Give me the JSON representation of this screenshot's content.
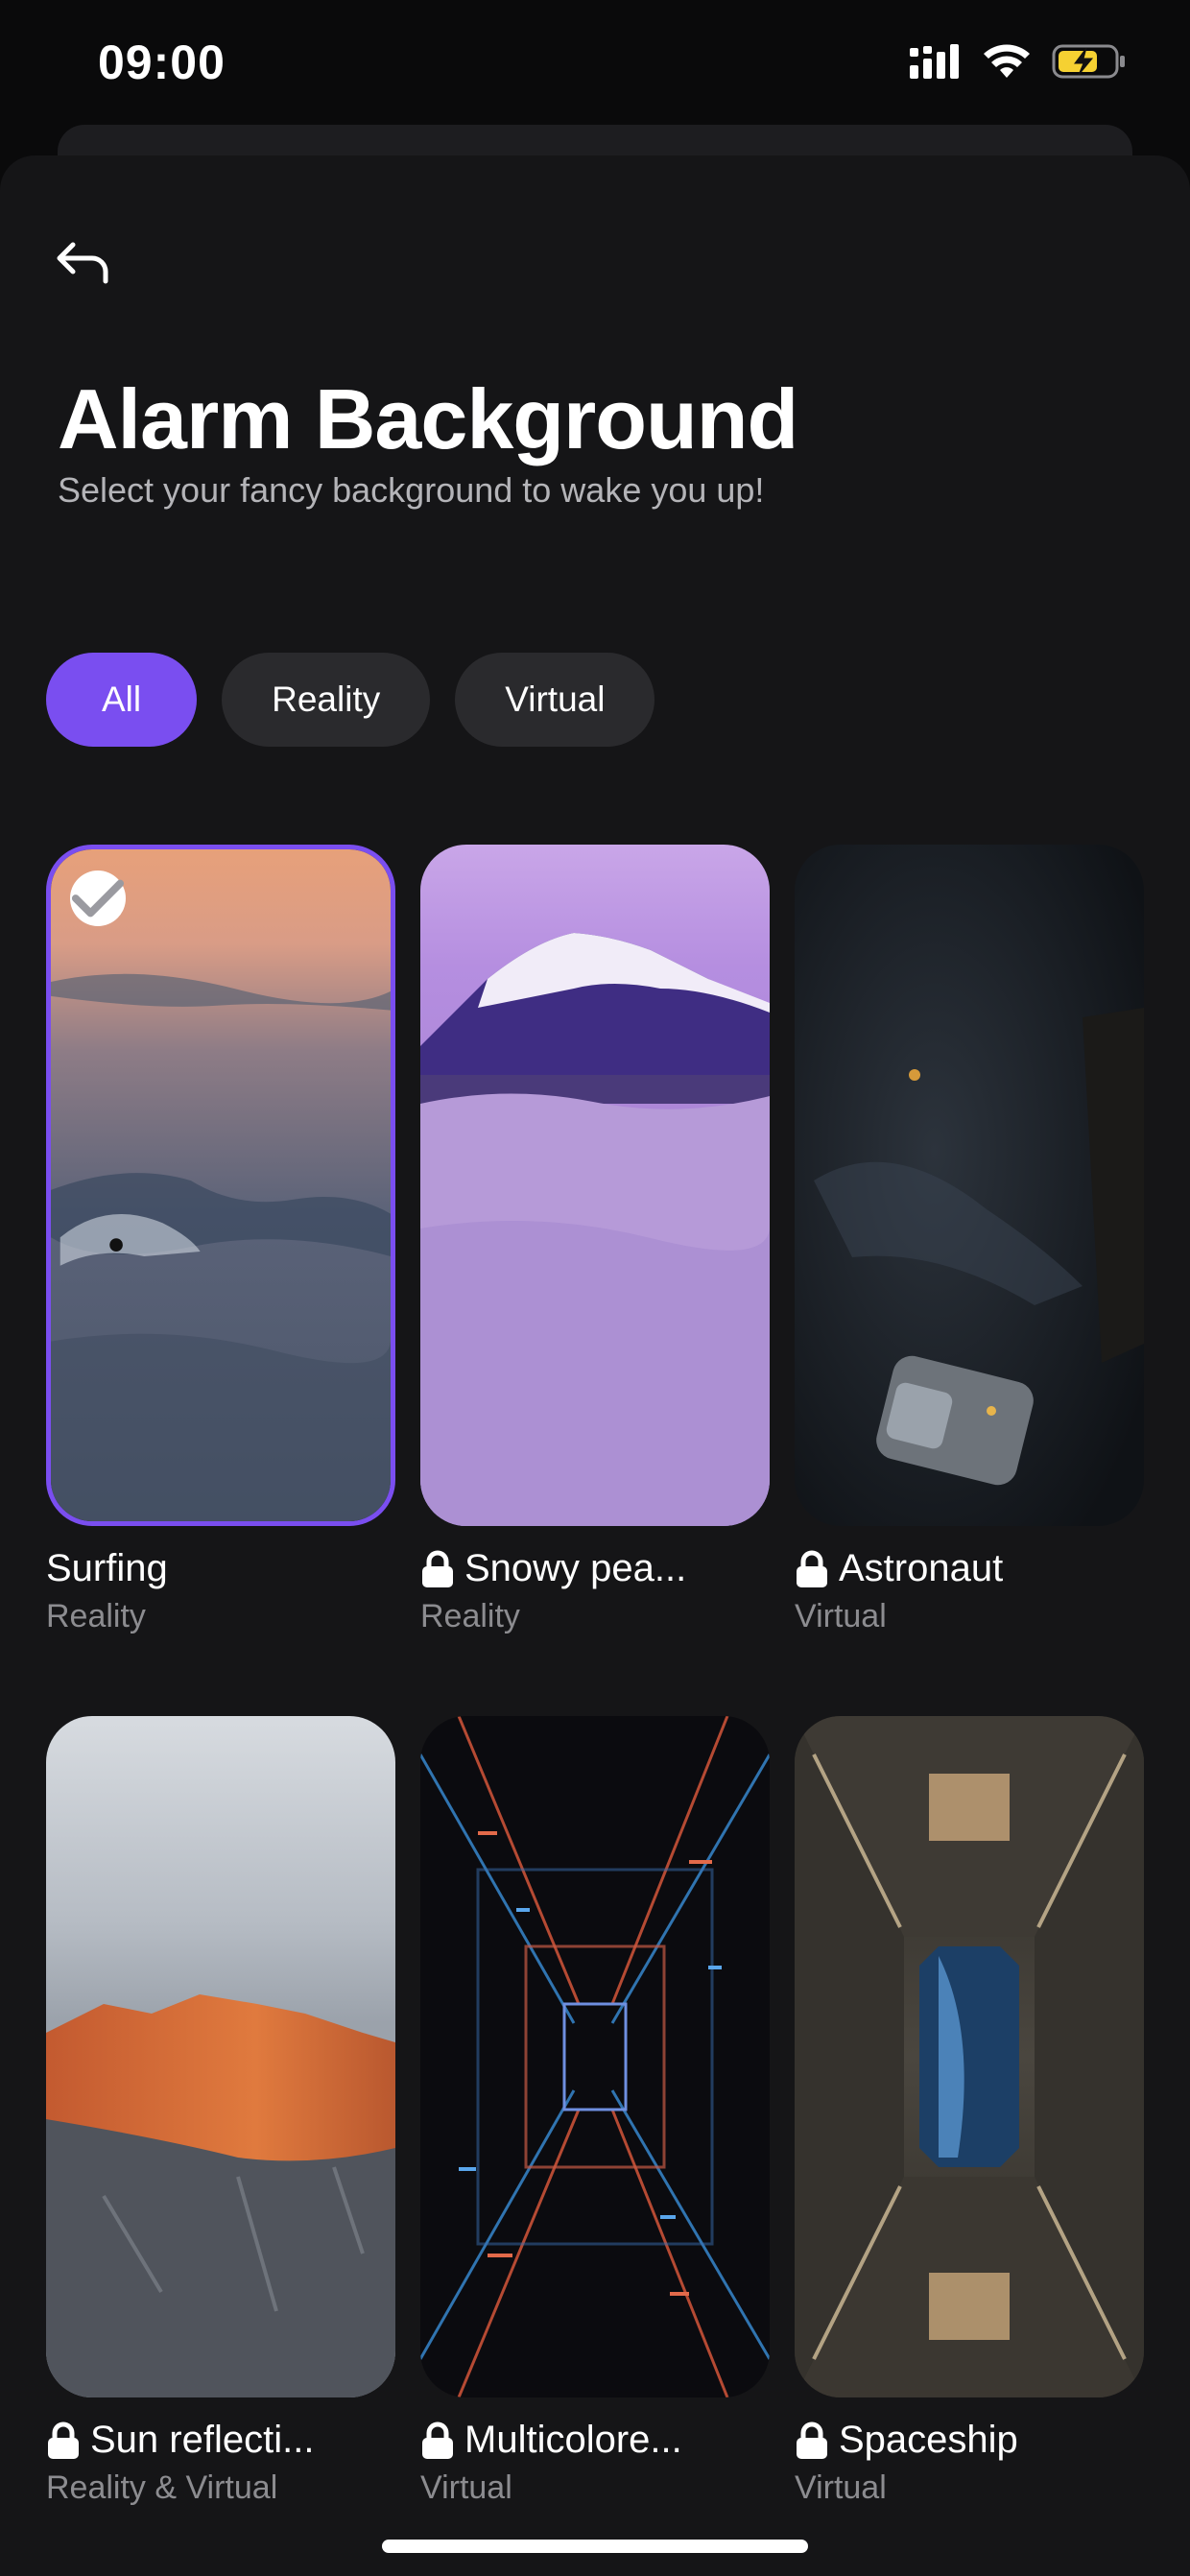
{
  "status": {
    "time": "09:00"
  },
  "page": {
    "title": "Alarm Background",
    "subtitle": "Select your fancy background to wake you up!"
  },
  "filters": [
    {
      "label": "All",
      "active": true
    },
    {
      "label": "Reality",
      "active": false
    },
    {
      "label": "Virtual",
      "active": false
    }
  ],
  "backgrounds": [
    {
      "title": "Surfing",
      "category": "Reality",
      "locked": false,
      "selected": true
    },
    {
      "title": "Snowy pea...",
      "category": "Reality",
      "locked": true,
      "selected": false
    },
    {
      "title": "Astronaut",
      "category": "Virtual",
      "locked": true,
      "selected": false
    },
    {
      "title": "Sun reflecti...",
      "category": "Reality & Virtual",
      "locked": true,
      "selected": false
    },
    {
      "title": "Multicolore...",
      "category": "Virtual",
      "locked": true,
      "selected": false
    },
    {
      "title": "Spaceship",
      "category": "Virtual",
      "locked": true,
      "selected": false
    }
  ],
  "colors": {
    "accent": "#7a4ef0",
    "background": "#151517",
    "chip": "#2a2a2d"
  },
  "icons": [
    "back-arrow-icon",
    "signal-icon",
    "wifi-icon",
    "battery-charging-icon",
    "lock-icon",
    "check-icon"
  ]
}
